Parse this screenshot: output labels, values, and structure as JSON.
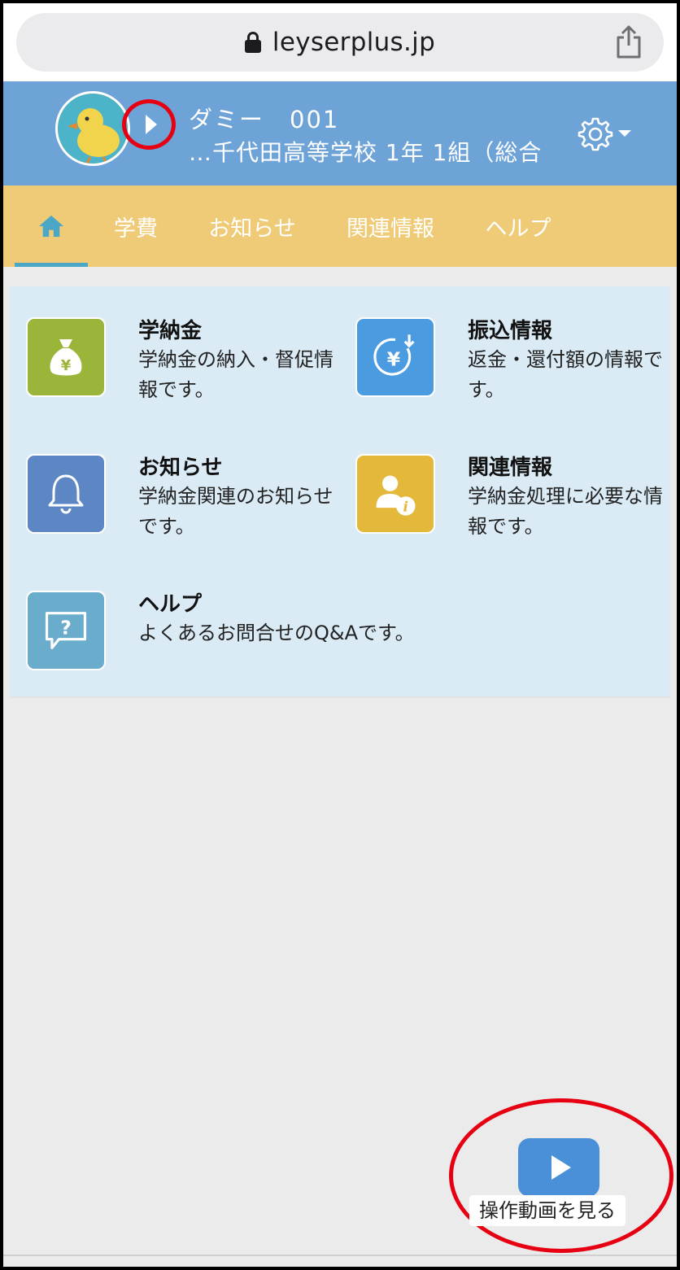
{
  "browser": {
    "url": "leyserplus.jp"
  },
  "header": {
    "user_name": "ダミー　001",
    "school": "…千代田高等学校 1年 1組（総合"
  },
  "tabs": [
    {
      "label": "学費"
    },
    {
      "label": "お知らせ"
    },
    {
      "label": "関連情報"
    },
    {
      "label": "ヘルプ"
    }
  ],
  "menu": [
    {
      "title": "学納金",
      "desc": "学納金の納入・督促情報です。",
      "icon": "money-bag-icon",
      "color": "#9bb53a"
    },
    {
      "title": "振込情報",
      "desc": "返金・還付額の情報です。",
      "icon": "yen-refund-icon",
      "color": "#4a9be0"
    },
    {
      "title": "お知らせ",
      "desc": "学納金関連のお知らせです。",
      "icon": "bell-icon",
      "color": "#5d86c4"
    },
    {
      "title": "関連情報",
      "desc": "学納金処理に必要な情報です。",
      "icon": "person-info-icon",
      "color": "#e4b83a"
    },
    {
      "title": "ヘルプ",
      "desc": "よくあるお問合せのQ&Aです。",
      "icon": "question-bubble-icon",
      "color": "#6aaccb"
    }
  ],
  "video": {
    "label": "操作動画を見る"
  },
  "colors": {
    "header_bg": "#6ea3d7",
    "tab_bg": "#f0cb77",
    "panel_bg": "#daebf6",
    "highlight": "#e60012"
  }
}
